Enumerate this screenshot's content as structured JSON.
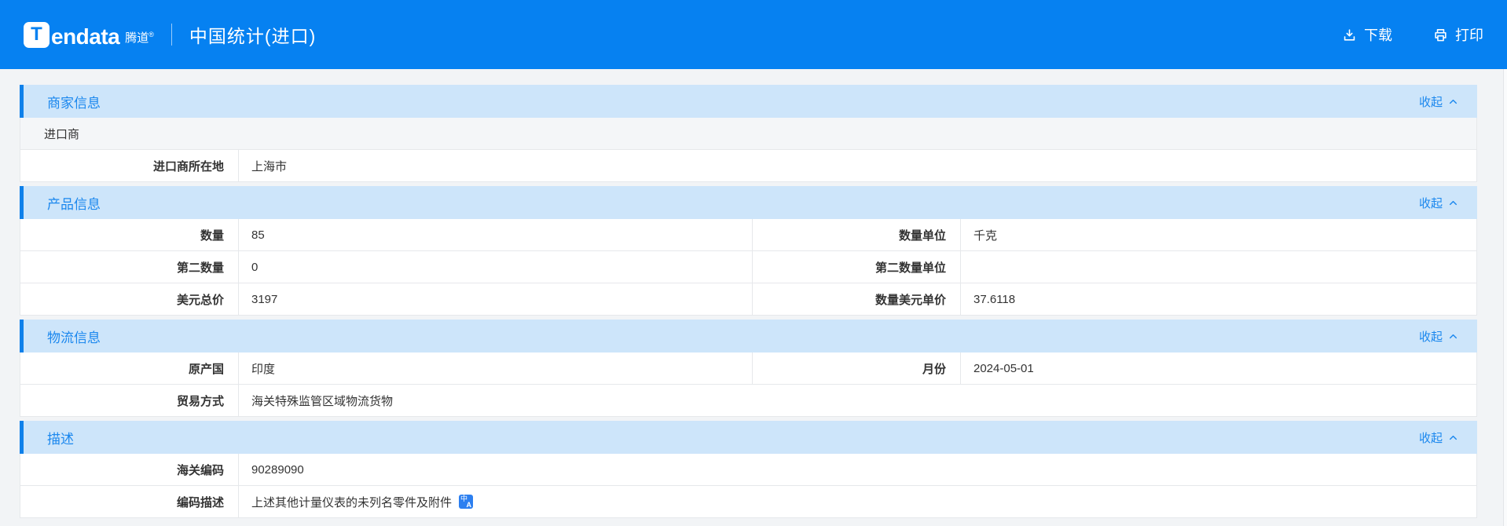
{
  "header": {
    "logo_glyph": "T",
    "logo_text": "endata",
    "logo_cn": "腾道",
    "logo_reg": "®",
    "title": "中国统计(进口)",
    "actions": {
      "download": "下载",
      "print": "打印"
    }
  },
  "ui": {
    "collapse_label": "收起",
    "icons": {
      "translate": {
        "glyph1": "中",
        "glyph2": "A"
      }
    },
    "colors": {
      "brand_blue": "#0681f1",
      "section_header_bg": "#cde5fa",
      "section_accent": "#0e80ea",
      "section_title_text": "#1a87ee",
      "row_border": "#e6e8eb",
      "plain_row_bg": "#f4f6f8",
      "page_bg": "#f2f4f6",
      "translate_icon_bg": "#2c7ff0"
    }
  },
  "sections": [
    {
      "title": "商家信息",
      "rows": [
        {
          "text": "进口商"
        },
        {
          "label": "进口商所在地",
          "value": "上海市"
        }
      ]
    },
    {
      "title": "产品信息",
      "rows": [
        {
          "label1": "数量",
          "value1": "85",
          "label2": "数量单位",
          "value2": "千克"
        },
        {
          "label1": "第二数量",
          "value1": "0",
          "label2": "第二数量单位",
          "value2": ""
        },
        {
          "label1": "美元总价",
          "value1": "3197",
          "label2": "数量美元单价",
          "value2": "37.6118"
        }
      ]
    },
    {
      "title": "物流信息",
      "rows": [
        {
          "label1": "原产国",
          "value1": "印度",
          "label2": "月份",
          "value2": "2024-05-01"
        },
        {
          "label": "贸易方式",
          "value": "海关特殊监管区域物流货物"
        }
      ]
    },
    {
      "title": "描述",
      "rows": [
        {
          "label": "海关编码",
          "value": "90289090"
        },
        {
          "label": "编码描述",
          "value": "上述其他计量仪表的未列名零件及附件"
        }
      ]
    }
  ]
}
